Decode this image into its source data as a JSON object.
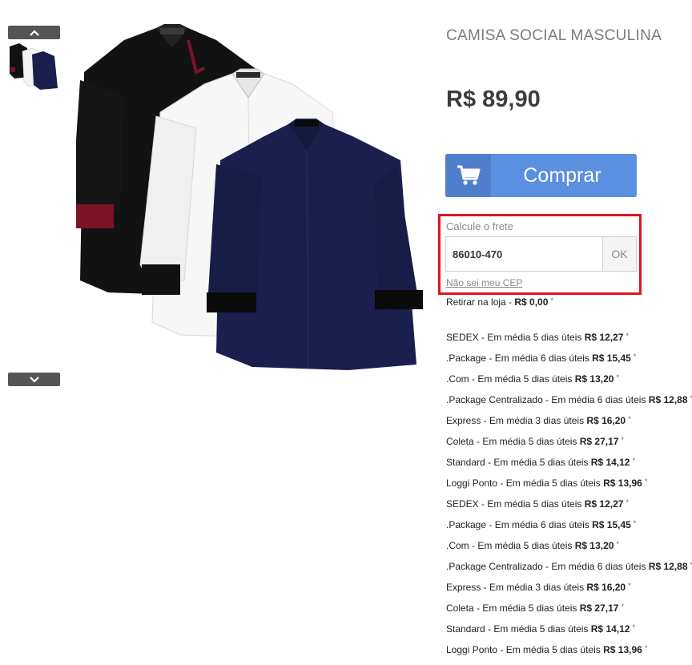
{
  "product": {
    "title": "CAMISA SOCIAL MASCULINA",
    "price": "R$ 89,90",
    "buy_label": "Comprar"
  },
  "gallery": {
    "up_icon": "chevron-up-icon",
    "down_icon": "chevron-down-icon",
    "shirt_colors": [
      "#111111",
      "#ffffff",
      "#1a1f4d"
    ],
    "cuff_accent": "#7a1428"
  },
  "shipping_calc": {
    "label": "Calcule o frete",
    "cep_value": "86010-470",
    "ok_label": "OK",
    "link_label": "Não sei meu CEP",
    "highlight_color": "#e0141e"
  },
  "pickup": {
    "label": "Retirar na loja - ",
    "price": "R$ 0,00",
    "asterisk": "*"
  },
  "shipping_options": [
    {
      "text": "SEDEX - Em média 5 dias úteis ",
      "price": "R$ 12,27",
      "asterisk": "*"
    },
    {
      "text": ".Package - Em média 6 dias úteis ",
      "price": "R$ 15,45",
      "asterisk": "*"
    },
    {
      "text": ".Com - Em média 5 dias úteis ",
      "price": "R$ 13,20",
      "asterisk": "*"
    },
    {
      "text": ".Package Centralizado - Em média 6 dias úteis ",
      "price": "R$ 12,88",
      "asterisk": "*"
    },
    {
      "text": "Express - Em média 3 dias úteis ",
      "price": "R$ 16,20",
      "asterisk": "*"
    },
    {
      "text": "Coleta - Em média 5 dias úteis ",
      "price": "R$ 27,17",
      "asterisk": "*"
    },
    {
      "text": "Standard - Em média 5 dias úteis ",
      "price": "R$ 14,12",
      "asterisk": "*"
    },
    {
      "text": "Loggi Ponto - Em média 5 dias úteis ",
      "price": "R$ 13,96",
      "asterisk": "*"
    },
    {
      "text": "SEDEX - Em média 5 dias úteis ",
      "price": "R$ 12,27",
      "asterisk": "*"
    },
    {
      "text": ".Package - Em média 6 dias úteis ",
      "price": "R$ 15,45",
      "asterisk": "*"
    },
    {
      "text": ".Com - Em média 5 dias úteis ",
      "price": "R$ 13,20",
      "asterisk": "*"
    },
    {
      "text": ".Package Centralizado - Em média 6 dias úteis ",
      "price": "R$ 12,88",
      "asterisk": "*"
    },
    {
      "text": "Express - Em média 3 dias úteis ",
      "price": "R$ 16,20",
      "asterisk": "*"
    },
    {
      "text": "Coleta - Em média 5 dias úteis ",
      "price": "R$ 27,17",
      "asterisk": "*"
    },
    {
      "text": "Standard - Em média 5 dias úteis ",
      "price": "R$ 14,12",
      "asterisk": "*"
    },
    {
      "text": "Loggi Ponto - Em média 5 dias úteis ",
      "price": "R$ 13,96",
      "asterisk": "*"
    }
  ]
}
